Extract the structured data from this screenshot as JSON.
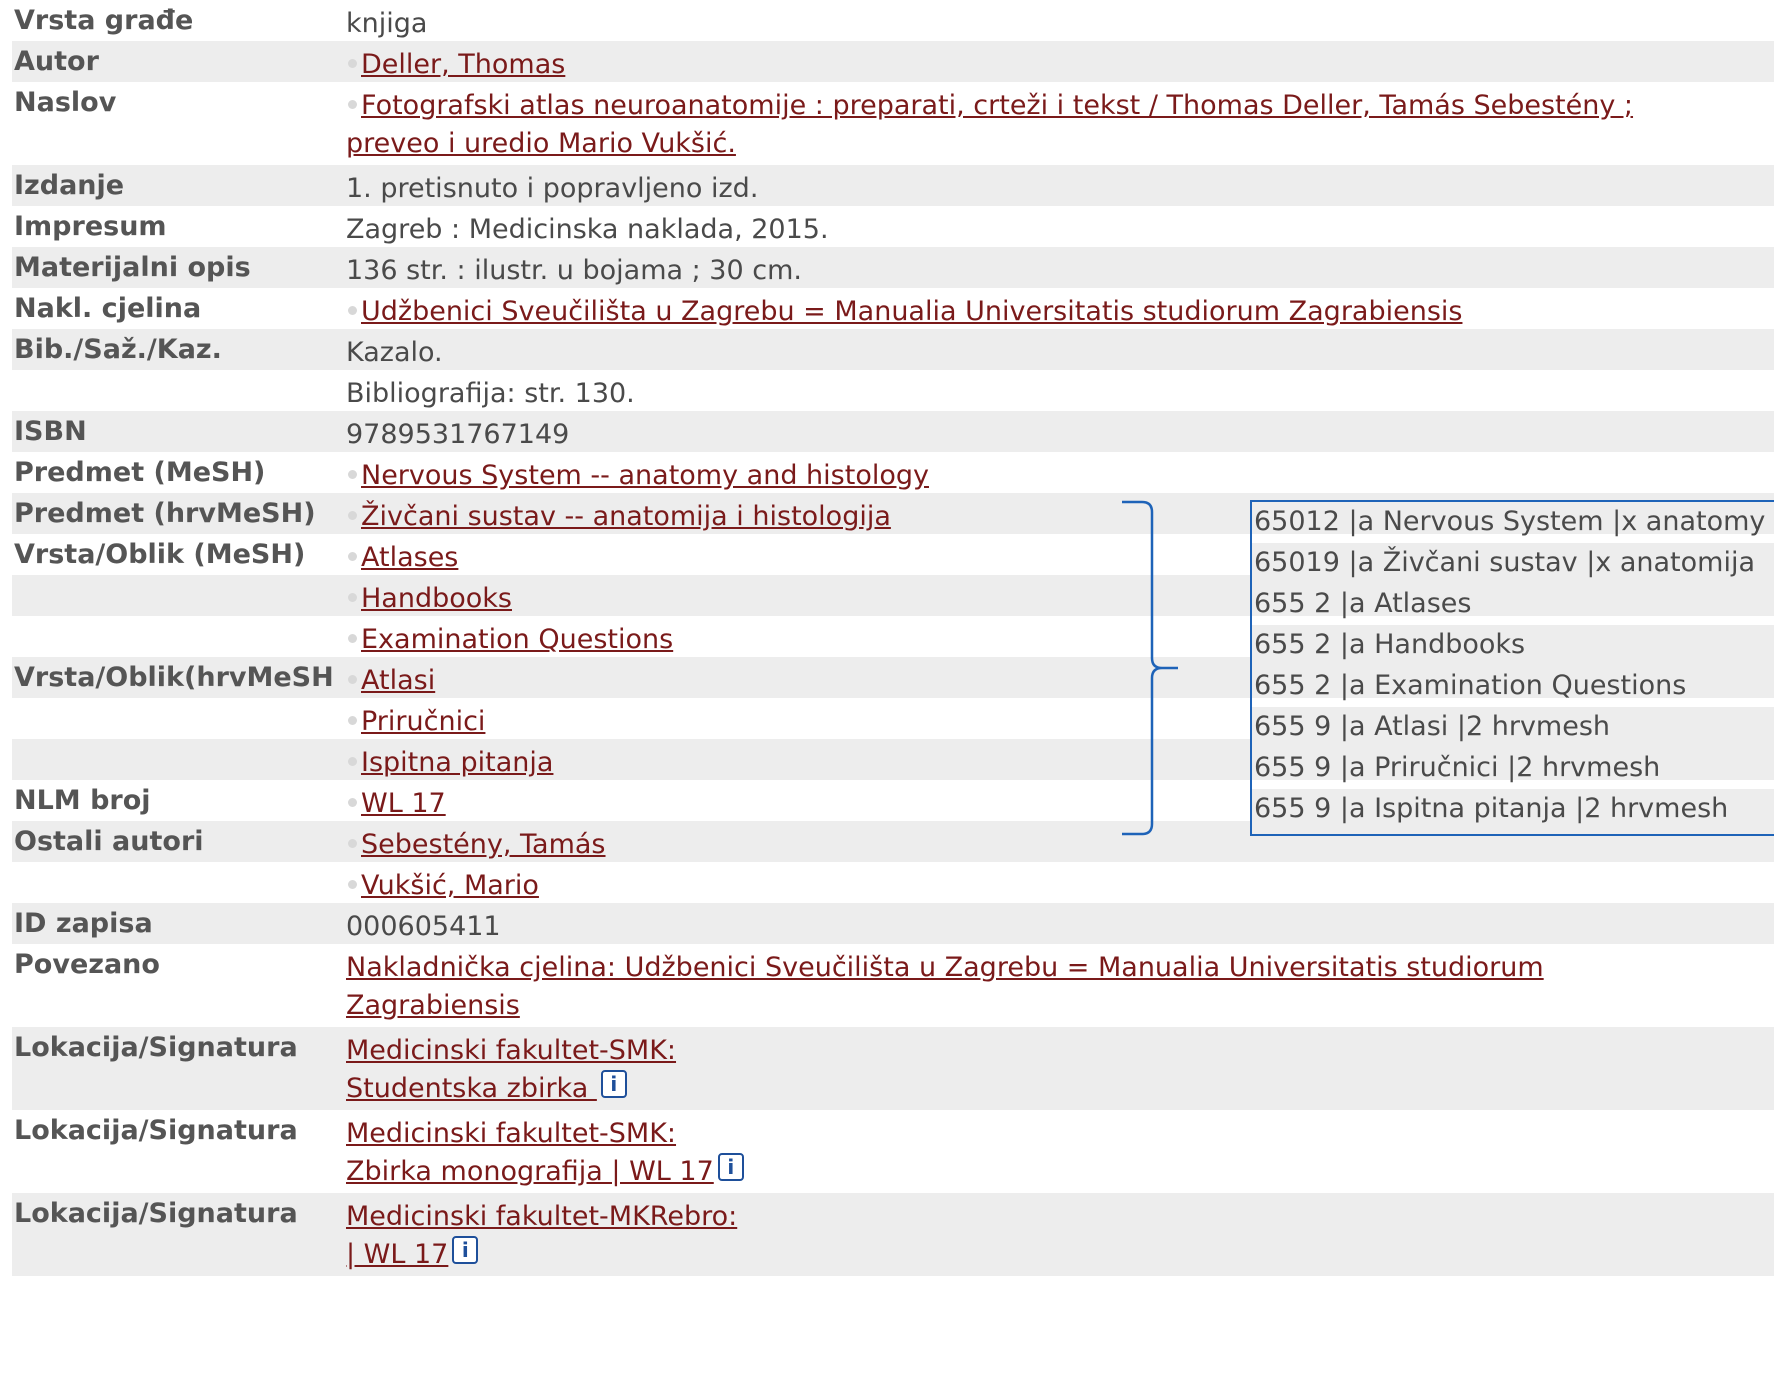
{
  "rows": [
    {
      "label": "Vrsta građe",
      "lines": [
        {
          "text": "knjiga",
          "link": false,
          "bullet": false
        }
      ]
    },
    {
      "label": "Autor",
      "lines": [
        {
          "text": "Deller, Thomas",
          "link": true,
          "bullet": true
        }
      ]
    },
    {
      "label": "Naslov",
      "lines": [
        {
          "text": "Fotografski atlas neuroanatomije : preparati, crteži i tekst / Thomas Deller, Tamás Sebestény ;",
          "link": true,
          "bullet": true
        },
        {
          "text": "preveo i uredio Mario Vukšić.",
          "link": true,
          "bullet": false
        }
      ]
    },
    {
      "label": "Izdanje",
      "lines": [
        {
          "text": "1. pretisnuto i popravljeno izd.",
          "link": false,
          "bullet": false
        }
      ]
    },
    {
      "label": "Impresum",
      "lines": [
        {
          "text": "Zagreb : Medicinska naklada, 2015.",
          "link": false,
          "bullet": false
        }
      ]
    },
    {
      "label": "Materijalni opis",
      "lines": [
        {
          "text": "136 str. : ilustr. u bojama ; 30 cm.",
          "link": false,
          "bullet": false
        }
      ]
    },
    {
      "label": "Nakl. cjelina",
      "lines": [
        {
          "text": "Udžbenici Sveučilišta u Zagrebu = Manualia Universitatis studiorum Zagrabiensis",
          "link": true,
          "bullet": true
        }
      ]
    },
    {
      "label": "Bib./Saž./Kaz.",
      "lines": [
        {
          "text": "Kazalo.",
          "link": false,
          "bullet": false
        }
      ]
    },
    {
      "label": "",
      "lines": [
        {
          "text": "Bibliografija: str. 130.",
          "link": false,
          "bullet": false
        }
      ]
    },
    {
      "label": "ISBN",
      "lines": [
        {
          "text": "9789531767149",
          "link": false,
          "bullet": false
        }
      ]
    },
    {
      "label": "Predmet (MeSH)",
      "lines": [
        {
          "text": "Nervous System -- anatomy and histology",
          "link": true,
          "bullet": true
        }
      ]
    },
    {
      "label": "Predmet (hrvMeSH)",
      "lines": [
        {
          "text": "Živčani sustav -- anatomija i histologija",
          "link": true,
          "bullet": true
        }
      ]
    },
    {
      "label": "Vrsta/Oblik (MeSH)",
      "lines": [
        {
          "text": "Atlases",
          "link": true,
          "bullet": true
        }
      ]
    },
    {
      "label": "",
      "lines": [
        {
          "text": "Handbooks",
          "link": true,
          "bullet": true
        }
      ]
    },
    {
      "label": "",
      "lines": [
        {
          "text": "Examination Questions",
          "link": true,
          "bullet": true
        }
      ]
    },
    {
      "label": "Vrsta/Oblik(hrvMeSH",
      "lines": [
        {
          "text": "Atlasi",
          "link": true,
          "bullet": true
        }
      ]
    },
    {
      "label": "",
      "lines": [
        {
          "text": "Priručnici",
          "link": true,
          "bullet": true
        }
      ]
    },
    {
      "label": "",
      "lines": [
        {
          "text": "Ispitna pitanja",
          "link": true,
          "bullet": true
        }
      ]
    },
    {
      "label": "NLM broj",
      "lines": [
        {
          "text": "WL 17",
          "link": true,
          "bullet": true
        }
      ]
    },
    {
      "label": "Ostali autori",
      "lines": [
        {
          "text": "Sebestény, Tamás",
          "link": true,
          "bullet": true
        }
      ]
    },
    {
      "label": "",
      "lines": [
        {
          "text": "Vukšić, Mario",
          "link": true,
          "bullet": true
        }
      ]
    },
    {
      "label": "ID zapisa",
      "lines": [
        {
          "text": "000605411",
          "link": false,
          "bullet": false
        }
      ]
    },
    {
      "label": "Povezano",
      "lines": [
        {
          "text": "Nakladnička cjelina: Udžbenici Sveučilišta u Zagrebu = Manualia Universitatis studiorum",
          "link": true,
          "bullet": false
        },
        {
          "text": "Zagrabiensis",
          "link": true,
          "bullet": false
        }
      ]
    },
    {
      "label": "Lokacija/Signatura",
      "lines": [
        {
          "text": "Medicinski fakultet-SMK:",
          "link": true,
          "bullet": false
        },
        {
          "text": " Studentska zbirka ",
          "link": true,
          "bullet": false,
          "info": true
        }
      ]
    },
    {
      "label": "Lokacija/Signatura",
      "lines": [
        {
          "text": "Medicinski fakultet-SMK:",
          "link": true,
          "bullet": false
        },
        {
          "text": " Zbirka monografija | WL 17",
          "link": true,
          "bullet": false,
          "info": true
        }
      ]
    },
    {
      "label": "Lokacija/Signatura",
      "lines": [
        {
          "text": "Medicinski fakultet-MKRebro:",
          "link": true,
          "bullet": false
        },
        {
          "text": " | WL 17",
          "link": true,
          "bullet": false,
          "info": true
        }
      ]
    }
  ],
  "info_icon_glyph": "i",
  "marc_lines": [
    "65012 |a Nervous System |x anatomy",
    "65019 |a Živčani sustav |x anatomija",
    "655 2  |a Atlases",
    "655 2  |a Handbooks",
    "655 2  |a Examination Questions",
    "655 9  |a Atlasi |2 hrvmesh",
    "655 9  |a Priručnici |2 hrvmesh",
    "655 9  |a Ispitna pitanja |2 hrvmesh"
  ],
  "colors": {
    "link": "#7a1a1a",
    "label": "#555555",
    "shade": "#ededed",
    "annotation": "#1e63b8"
  }
}
